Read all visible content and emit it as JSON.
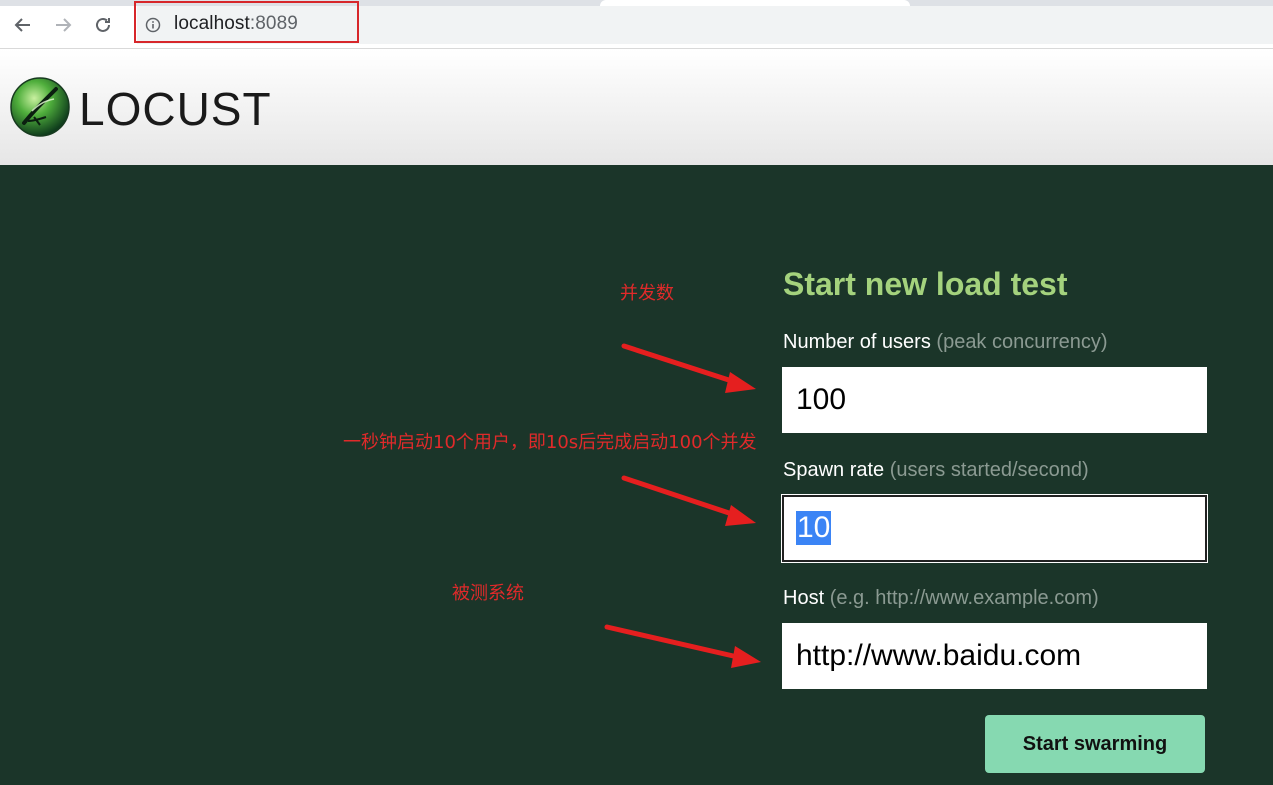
{
  "browser": {
    "url_host": "localhost",
    "url_port": ":8089"
  },
  "app": {
    "logo_text": "LOCUST"
  },
  "form": {
    "title": "Start new load test",
    "users": {
      "label": "Number of users",
      "hint": "(peak concurrency)",
      "value": "100"
    },
    "spawn": {
      "label": "Spawn rate",
      "hint": "(users started/second)",
      "value": "10"
    },
    "host": {
      "label": "Host",
      "hint": "(e.g. http://www.example.com)",
      "value": "http://www.baidu.com"
    },
    "submit_label": "Start swarming"
  },
  "annotations": {
    "users_note": "并发数",
    "spawn_note": "一秒钟启动10个用户，即10s后完成启动100个并发",
    "host_note": "被测系统"
  },
  "colors": {
    "background": "#1b3529",
    "title": "#a4d27d",
    "button": "#86d9b1",
    "annotation": "#e02a2a"
  }
}
